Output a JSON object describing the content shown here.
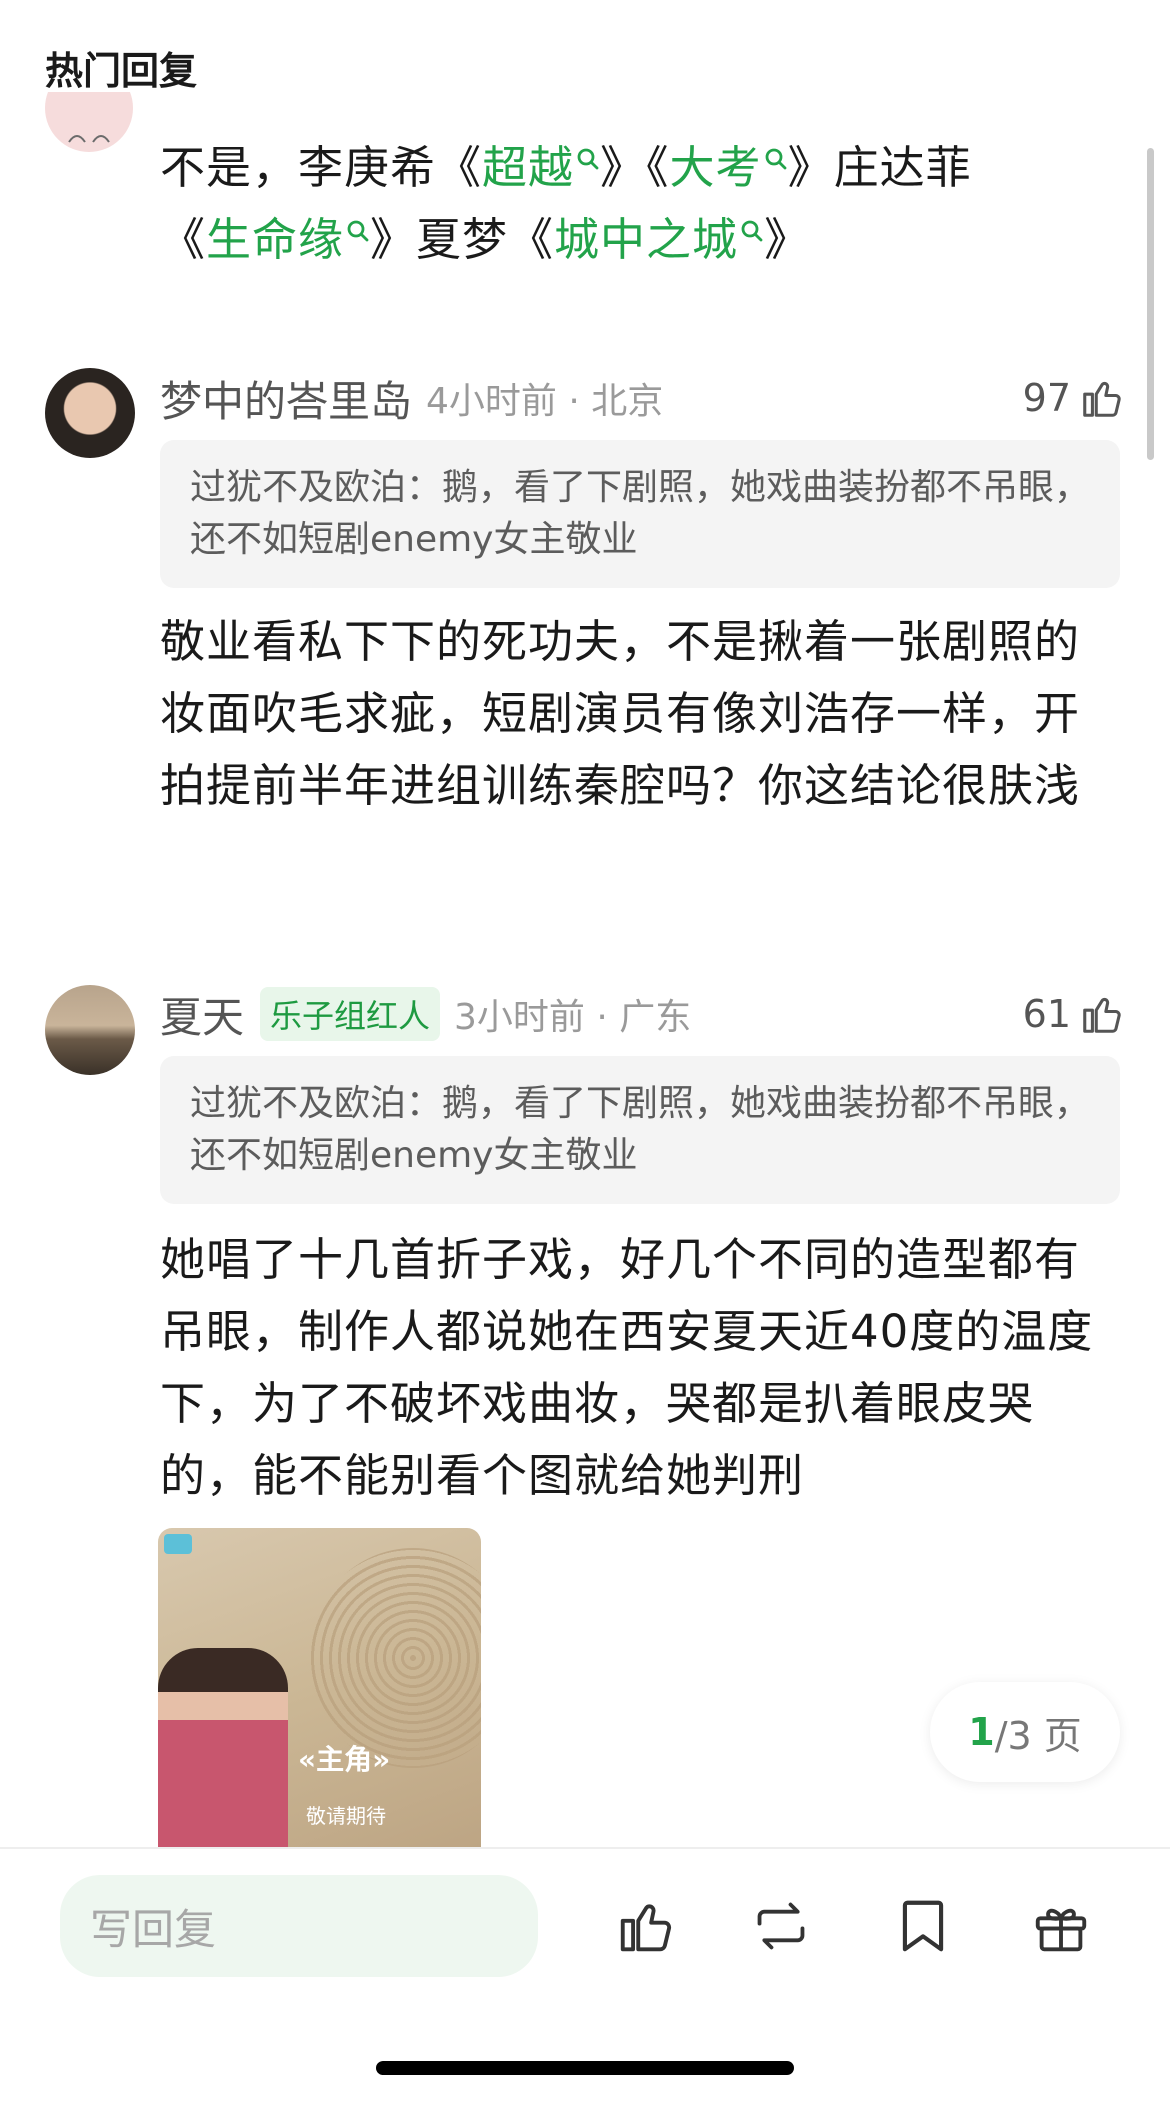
{
  "header": {
    "title": "热门回复"
  },
  "top_reply": {
    "line1": [
      {
        "text": "不是，李庚希《",
        "link": false
      },
      {
        "text": "超越",
        "link": true
      },
      {
        "text": "》《",
        "link": false
      },
      {
        "text": "大考",
        "link": true
      },
      {
        "text": "》庄达菲",
        "link": false
      }
    ],
    "line2": [
      {
        "text": "《",
        "link": false
      },
      {
        "text": "生命缘",
        "link": true
      },
      {
        "text": "》夏梦《",
        "link": false
      },
      {
        "text": "城中之城",
        "link": true
      },
      {
        "text": "》",
        "link": false
      }
    ]
  },
  "comments": [
    {
      "username": "梦中的峇里岛",
      "badge": "",
      "time": "4小时前 · 北京",
      "likes": "97",
      "quote": "过犹不及欧泊：鹅，看了下剧照，她戏曲装扮都不吊眼，还不如短剧enemy女主敬业",
      "body": "敬业看私下下的死功夫，不是揪着一张剧照的妆面吹毛求疵，短剧演员有像刘浩存一样，开拍提前半年进组训练秦腔吗？你这结论很肤浅"
    },
    {
      "username": "夏天",
      "badge": "乐子组红人",
      "time": "3小时前 · 广东",
      "likes": "61",
      "quote": "过犹不及欧泊：鹅，看了下剧照，她戏曲装扮都不吊眼，还不如短剧enemy女主敬业",
      "body": "她唱了十几首折子戏，好几个不同的造型都有吊眼，制作人都说她在西安夏天近40度的温度下，为了不破坏戏曲妆，哭都是扒着眼皮哭的，能不能别看个图就给她判刑",
      "image": {
        "title": "«主角»",
        "subtitle": "敬请期待"
      }
    }
  ],
  "pager": {
    "current": "1",
    "rest": "/3 页"
  },
  "bottom_bar": {
    "reply_placeholder": "写回复",
    "icons": [
      "thumbs-up-icon",
      "repost-icon",
      "bookmark-icon",
      "gift-icon"
    ]
  },
  "colors": {
    "link": "#22a34a",
    "badge_bg": "#e8f6ea",
    "input_bg": "#eef7f0"
  }
}
